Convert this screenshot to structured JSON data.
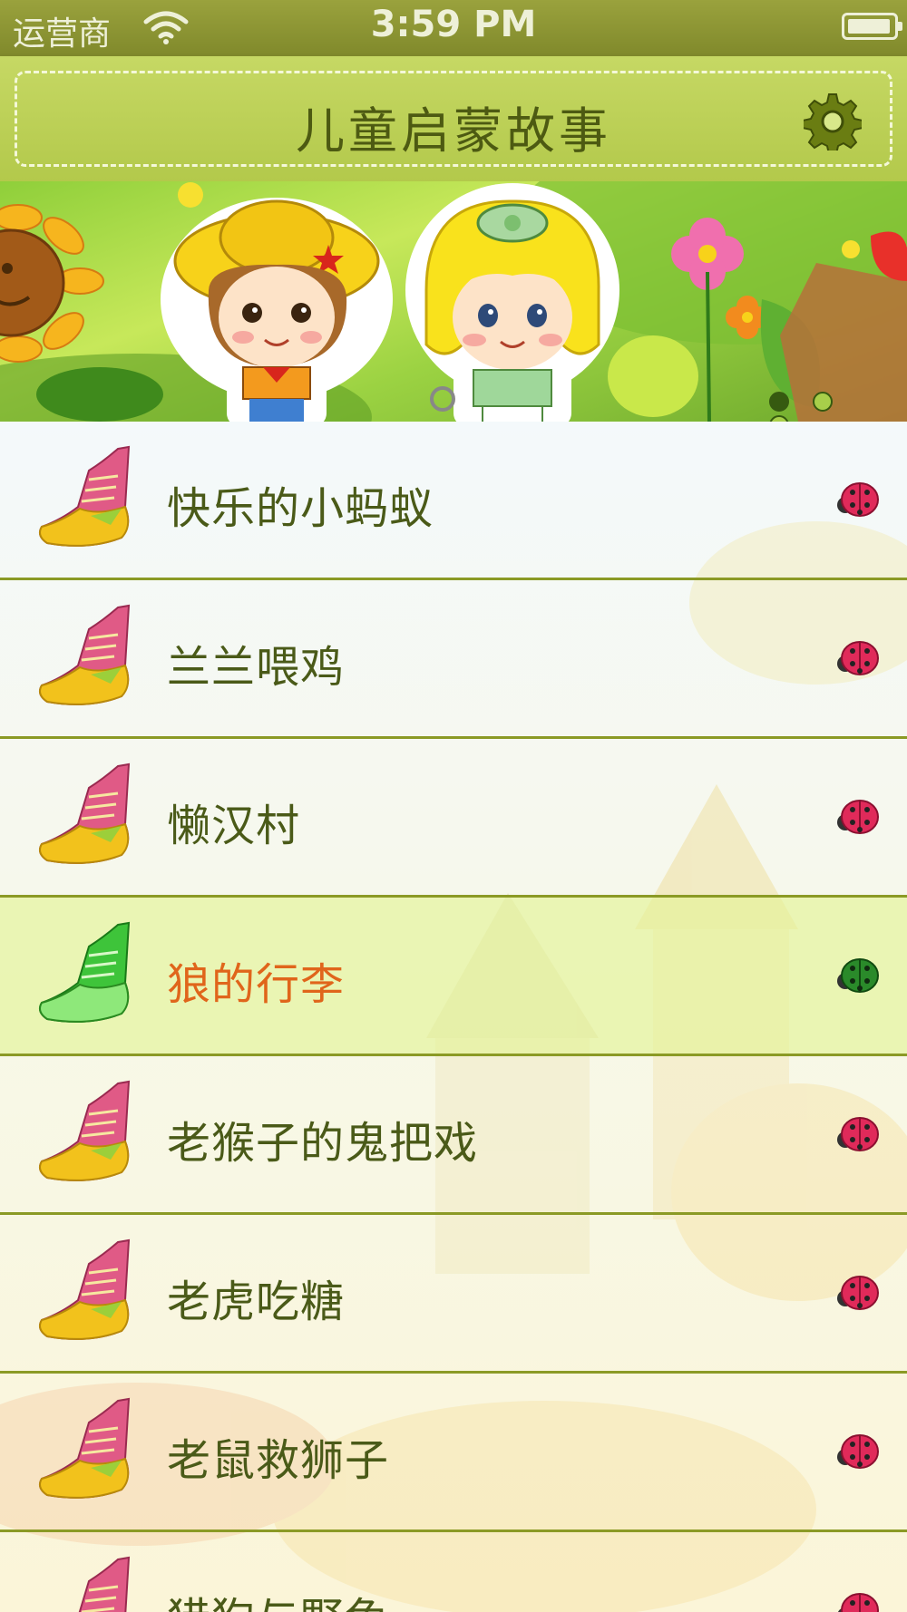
{
  "status_bar": {
    "carrier": "运营商",
    "time": "3:59 PM"
  },
  "navbar": {
    "title": "儿童启蒙故事"
  },
  "banner": {
    "pages": 3,
    "current_page": 1
  },
  "stories": [
    {
      "title": "快乐的小蚂蚁",
      "selected": false
    },
    {
      "title": "兰兰喂鸡",
      "selected": false
    },
    {
      "title": "懒汉村",
      "selected": false
    },
    {
      "title": "狼的行李",
      "selected": true
    },
    {
      "title": "老猴子的鬼把戏",
      "selected": false
    },
    {
      "title": "老虎吃糖",
      "selected": false
    },
    {
      "title": "老鼠救狮子",
      "selected": false
    },
    {
      "title": "猎狗与野兔",
      "selected": false
    }
  ],
  "colors": {
    "accent": "#8b9a25",
    "selected_text": "#e0651b",
    "text": "#4a5a18"
  },
  "icons": {
    "row_icon": "sneaker-icon",
    "row_indicator": "ladybug-icon",
    "settings": "gear-icon"
  }
}
